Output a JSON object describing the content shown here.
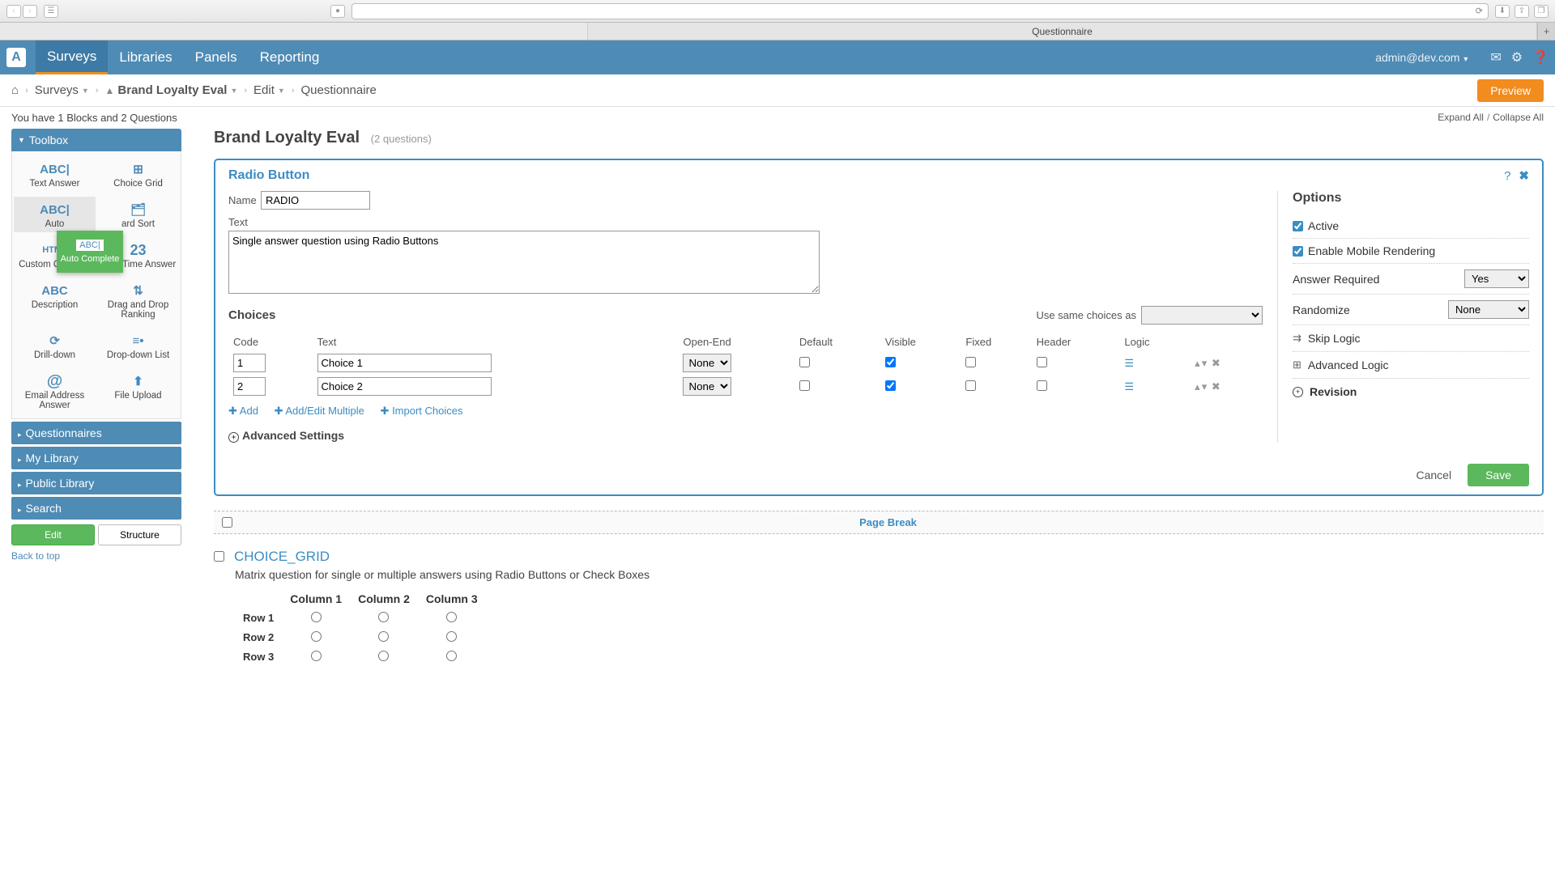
{
  "browser": {
    "tab_title": "Questionnaire"
  },
  "topnav": {
    "logo_letter": "A",
    "items": [
      "Surveys",
      "Libraries",
      "Panels",
      "Reporting"
    ],
    "user": "admin@dev.com"
  },
  "breadcrumb": {
    "surveys": "Surveys",
    "survey_name": "Brand Loyalty Eval",
    "edit": "Edit",
    "page": "Questionnaire",
    "preview_btn": "Preview"
  },
  "subheader": {
    "summary": "You have 1 Blocks and 2 Questions",
    "expand": "Expand All",
    "collapse": "Collapse All"
  },
  "sidebar": {
    "toolbox_title": "Toolbox",
    "tools": [
      {
        "icon": "ABC|",
        "label": "Text Answer"
      },
      {
        "icon": "⊞",
        "label": "Choice Grid"
      },
      {
        "icon": "ABC|",
        "label": "Auto"
      },
      {
        "icon": "🗂",
        "label": "ard Sort"
      },
      {
        "icon": "HTML",
        "label": "Custom Question"
      },
      {
        "icon": "23",
        "label": "Date Time Answer"
      },
      {
        "icon": "ABC",
        "label": "Description"
      },
      {
        "icon": "⇅",
        "label": "Drag and Drop Ranking"
      },
      {
        "icon": "⟳",
        "label": "Drill-down"
      },
      {
        "icon": "≡•",
        "label": "Drop-down List"
      },
      {
        "icon": "@",
        "label": "Email Address Answer"
      },
      {
        "icon": "⬆",
        "label": "File Upload"
      }
    ],
    "drag_ghost": {
      "icon": "ABC|",
      "label": "Auto Complete"
    },
    "sections": [
      "Questionnaires",
      "My Library",
      "Public Library",
      "Search"
    ],
    "edit_btn": "Edit",
    "structure_btn": "Structure",
    "back": "Back to top"
  },
  "survey": {
    "title": "Brand Loyalty Eval",
    "q_count": "(2 questions)"
  },
  "editor": {
    "type_label": "Radio Button",
    "name_label": "Name",
    "name_value": "RADIO",
    "text_label": "Text",
    "text_value": "Single answer question using Radio Buttons",
    "choices_label": "Choices",
    "same_choices_label": "Use same choices as",
    "columns": {
      "code": "Code",
      "text": "Text",
      "openend": "Open-End",
      "default": "Default",
      "visible": "Visible",
      "fixed": "Fixed",
      "header": "Header",
      "logic": "Logic"
    },
    "rows": [
      {
        "code": "1",
        "text": "Choice 1",
        "openend": "None",
        "default": false,
        "visible": true,
        "fixed": false,
        "header": false
      },
      {
        "code": "2",
        "text": "Choice 2",
        "openend": "None",
        "default": false,
        "visible": true,
        "fixed": false,
        "header": false
      }
    ],
    "add_links": {
      "add": "Add",
      "multi": "Add/Edit Multiple",
      "import": "Import Choices"
    },
    "advanced_settings": "Advanced Settings",
    "cancel": "Cancel",
    "save": "Save"
  },
  "options": {
    "title": "Options",
    "active": "Active",
    "mobile": "Enable Mobile Rendering",
    "answer_req_label": "Answer Required",
    "answer_req_value": "Yes",
    "randomize_label": "Randomize",
    "randomize_value": "None",
    "skip_logic": "Skip Logic",
    "advanced_logic": "Advanced Logic",
    "revision": "Revision"
  },
  "page_break": {
    "label": "Page Break"
  },
  "q2": {
    "name": "CHOICE_GRID",
    "desc": "Matrix question for single or multiple answers using Radio Buttons or Check Boxes",
    "cols": [
      "Column 1",
      "Column 2",
      "Column 3"
    ],
    "rows": [
      "Row 1",
      "Row 2",
      "Row 3"
    ]
  }
}
